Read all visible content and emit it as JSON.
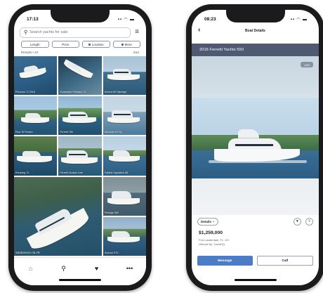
{
  "left_screen": {
    "status": {
      "time": "17:13",
      "icons": "▪▪ ◠ ▬"
    },
    "search": {
      "placeholder": "Search yachts for sale"
    },
    "filters": [
      {
        "label": "Length"
      },
      {
        "label": "Price"
      },
      {
        "label": "Location"
      },
      {
        "label": "More"
      }
    ],
    "results": {
      "count": "Results • 24",
      "sort": "Sort"
    },
    "tiles": [
      {
        "caption": "Princess 72 2018"
      },
      {
        "caption": "Sunseeker Predator 74"
      },
      {
        "caption": "Azimut 66 Flybridge"
      },
      {
        "caption": "Riva 76 Perseo"
      },
      {
        "caption": "Ferretti 780"
      },
      {
        "caption": "Absolute 62 Fly"
      },
      {
        "caption": "Pershing 7X"
      },
      {
        "caption": "Ferretti Custom Line"
      },
      {
        "caption": "Fairline Squadron 68"
      },
      {
        "caption": "Sanlorenzo SL78"
      },
      {
        "caption": "Prestige 680"
      },
      {
        "caption": "Horizon E75"
      }
    ],
    "tabs": [
      {
        "name": "home",
        "glyph": "⌂"
      },
      {
        "name": "search",
        "glyph": "⚲"
      },
      {
        "name": "favorites",
        "glyph": "♥"
      },
      {
        "name": "more",
        "glyph": "•••"
      }
    ]
  },
  "right_screen": {
    "status": {
      "time": "08:23",
      "icons": "▪▪ ◠ ▬"
    },
    "header": {
      "back": "‹",
      "title": "Boat Details"
    },
    "boat_title": "2016 Ferretti Yachts 550",
    "photo_count": "1/40",
    "details_label": "Details",
    "price": "$1,259,000",
    "location": "Fort Lauderdale, FL, US",
    "offered_by": "Offered By: YachtHQ",
    "buttons": {
      "message": "Message",
      "call": "Call"
    }
  },
  "colors": {
    "accent": "#4d7cc6",
    "title_bar": "#4e5a72"
  }
}
